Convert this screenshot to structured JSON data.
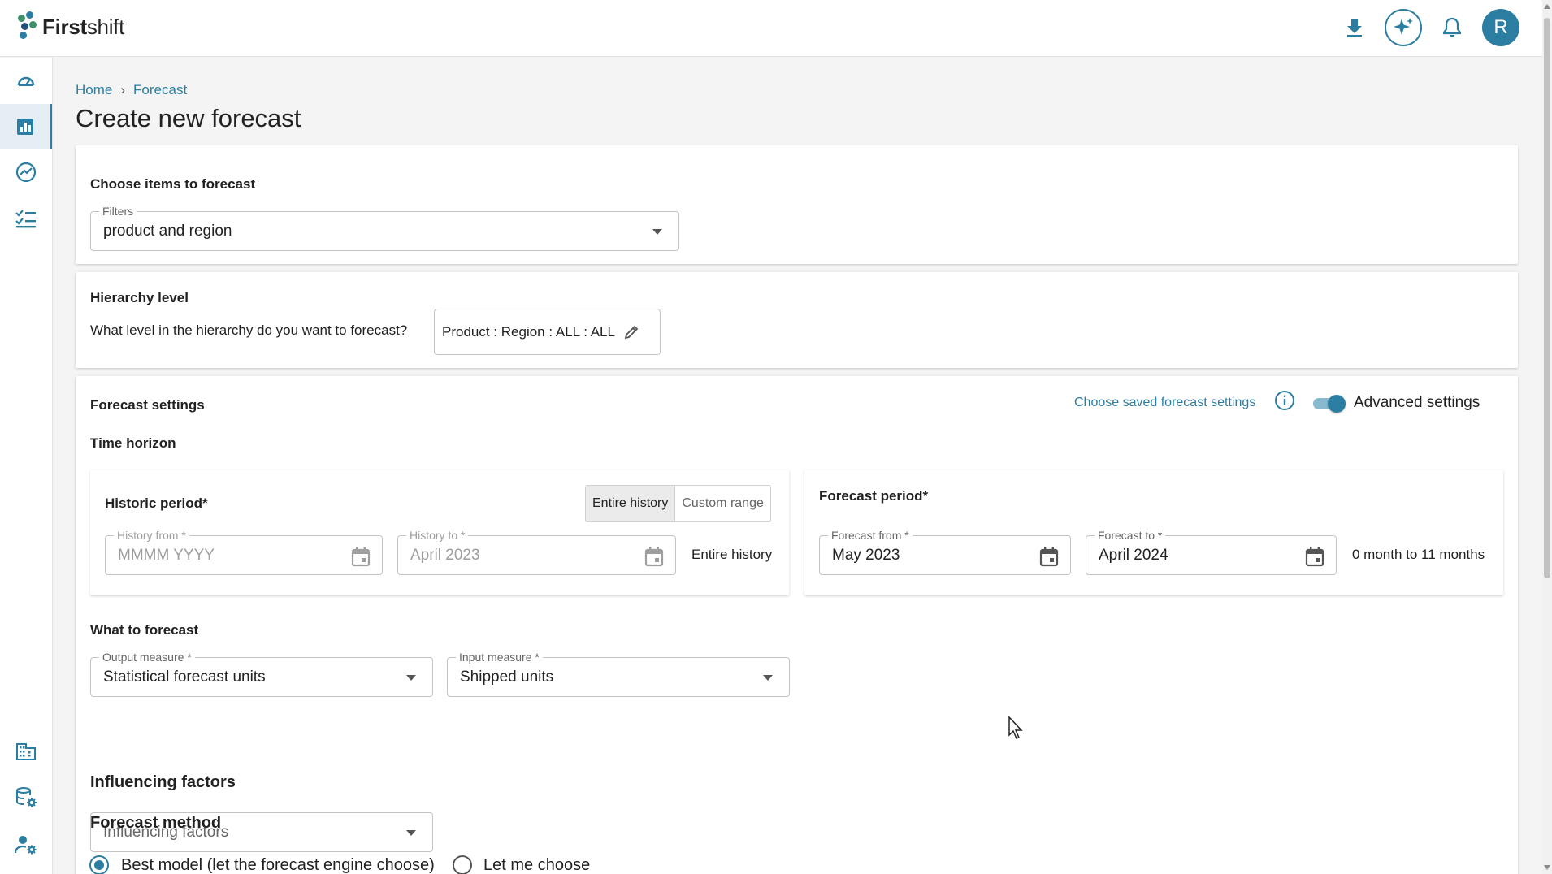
{
  "app": {
    "brand_bold": "First",
    "brand_light": "shift"
  },
  "topbar": {
    "avatar_initial": "R",
    "icons": [
      "download-icon",
      "ai-sparkle-icon",
      "bell-icon"
    ]
  },
  "sidenav": {
    "items": [
      "dashboard-icon",
      "forecast-chart-icon",
      "trend-icon",
      "checklist-icon",
      "organization-icon",
      "database-settings-icon",
      "user-settings-icon"
    ],
    "active": "forecast-chart-icon"
  },
  "breadcrumb": {
    "home": "Home",
    "separator": "›",
    "current": "Forecast"
  },
  "page": {
    "title": "Create new forecast"
  },
  "choose_items": {
    "title": "Choose items to forecast",
    "filters_label": "Filters",
    "filters_value": "product and region"
  },
  "hierarchy": {
    "title": "Hierarchy level",
    "question": "What level in the hierarchy do you want to forecast?",
    "value": "Product : Region : ALL : ALL"
  },
  "forecast_settings": {
    "title": "Forecast settings",
    "saved_settings_link": "Choose saved forecast settings",
    "advanced_label": "Advanced settings",
    "advanced_enabled": true,
    "time_horizon": "Time horizon",
    "historic": {
      "title": "Historic period*",
      "toggle_entire": "Entire history",
      "toggle_custom": "Custom range",
      "from_label": "History from *",
      "from_placeholder": "MMMM YYYY",
      "to_label": "History to *",
      "to_value": "April 2023",
      "summary": "Entire history"
    },
    "forecast_period": {
      "title": "Forecast period*",
      "from_label": "Forecast from *",
      "from_value": "May 2023",
      "to_label": "Forecast to *",
      "to_value": "April 2024",
      "summary": "0 month to 11 months"
    },
    "what_to_forecast": {
      "title": "What to forecast",
      "output_label": "Output measure *",
      "output_value": "Statistical forecast units",
      "input_label": "Input measure *",
      "input_value": "Shipped units"
    },
    "influencing": {
      "title": "Influencing factors",
      "placeholder": "Influencing factors"
    },
    "method": {
      "title": "Forecast method",
      "option_best": "Best model (let the forecast engine choose)",
      "option_manual": "Let me choose",
      "selected": "best"
    }
  },
  "colors": {
    "accent": "#2b7ea1",
    "logo_green": "#3f8f6b",
    "logo_teal": "#2b7ea1",
    "logo_blue": "#1f4e79"
  }
}
